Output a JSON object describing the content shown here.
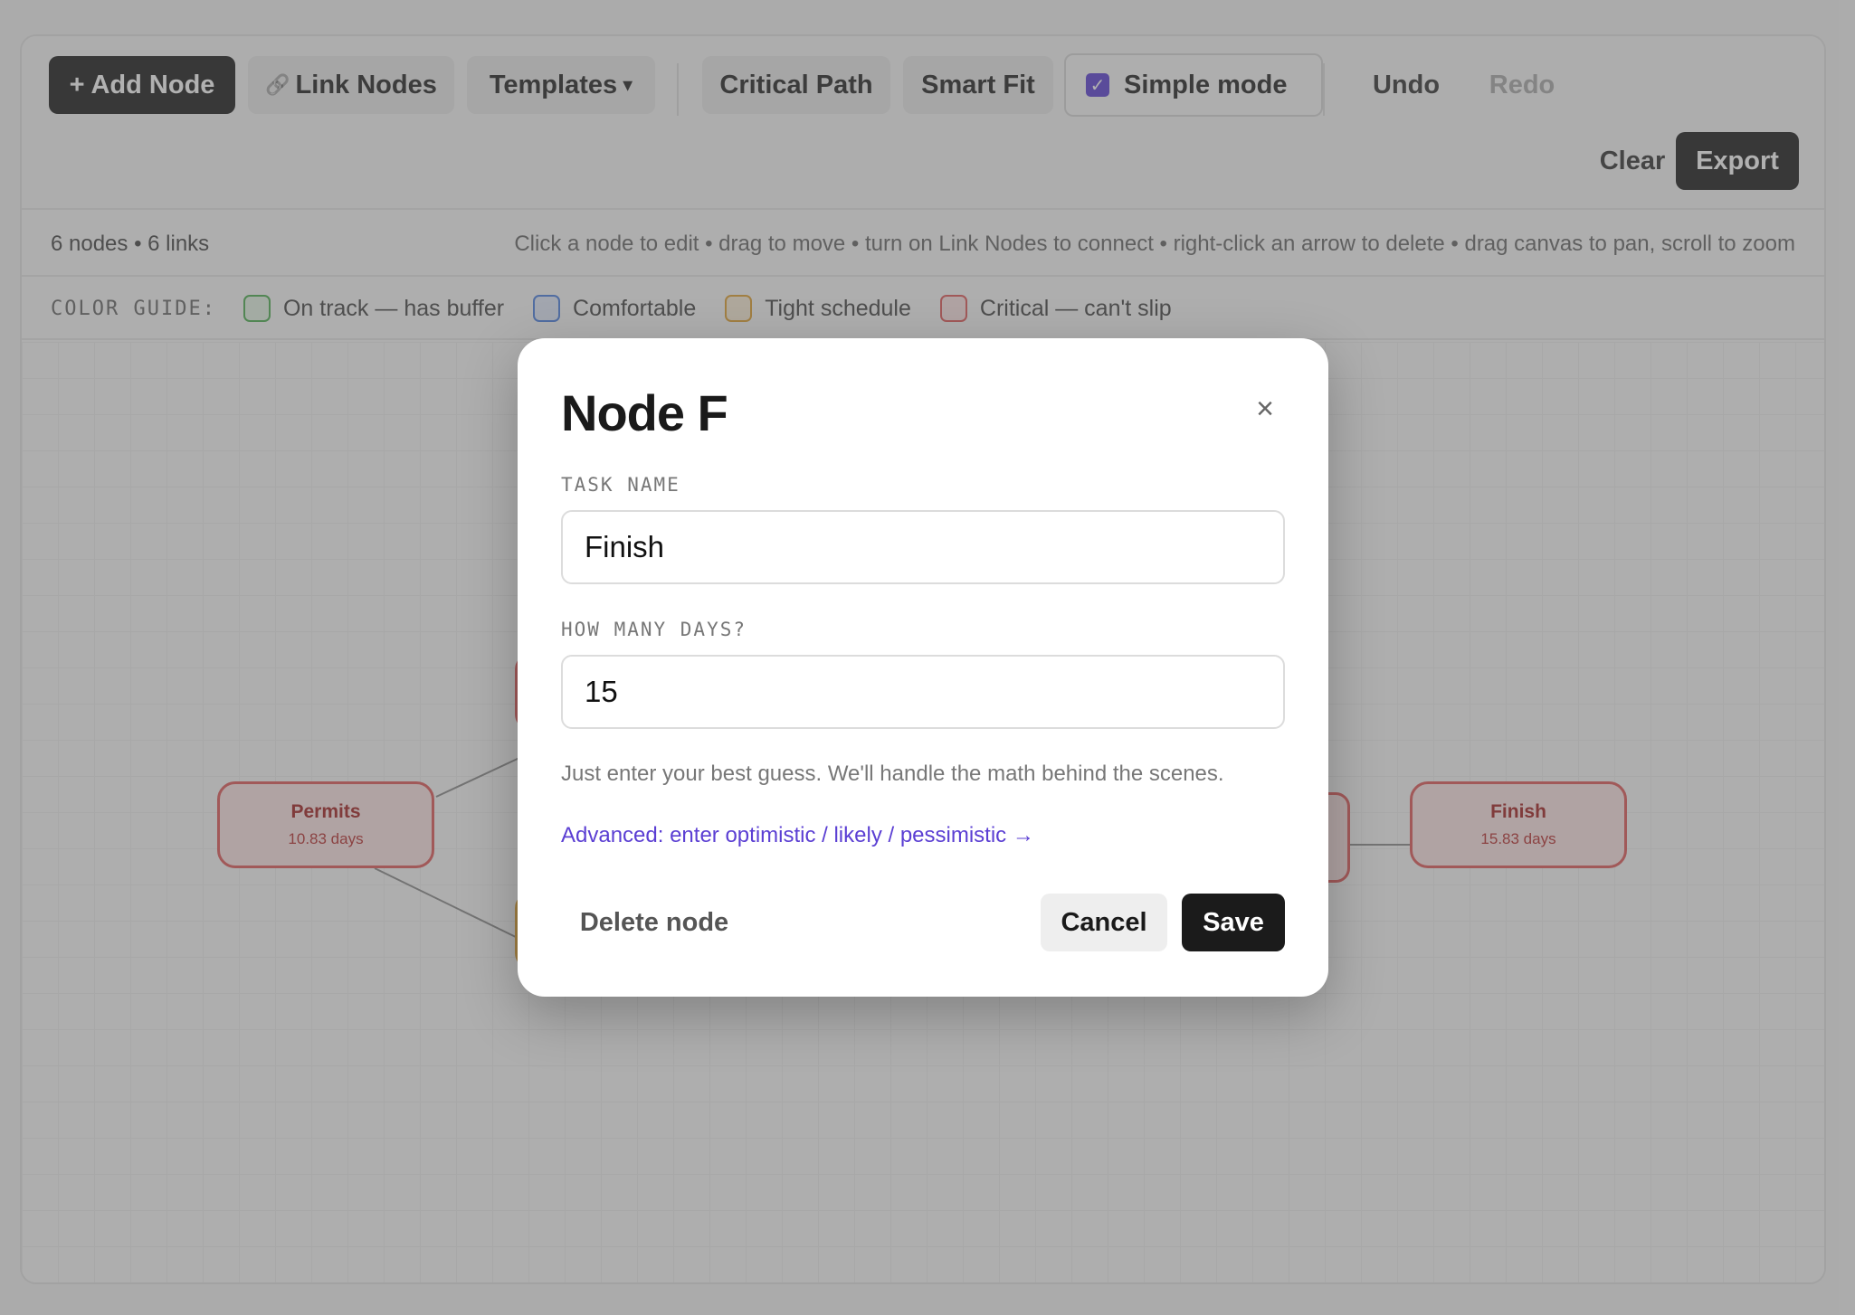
{
  "toolbar": {
    "add_node": "+ Add Node",
    "link_nodes": "Link Nodes",
    "link_icon": "🔗",
    "templates": "Templates",
    "templates_caret": "▾",
    "critical_path": "Critical Path",
    "smart_fit": "Smart Fit",
    "simple_mode": "Simple mode",
    "simple_mode_checked": true,
    "undo": "Undo",
    "redo": "Redo",
    "clear": "Clear",
    "export": "Export"
  },
  "status": {
    "counts": "6 nodes • 6 links",
    "hint": "Click a node to edit • drag to move • turn on Link Nodes to connect • right-click an arrow to delete • drag canvas to pan, scroll to zoom"
  },
  "legend": {
    "label": "COLOR GUIDE:",
    "items": [
      {
        "label": "On track — has buffer",
        "color": "#4caf50"
      },
      {
        "label": "Comfortable",
        "color": "#4a7fe0"
      },
      {
        "label": "Tight schedule",
        "color": "#e0a030"
      },
      {
        "label": "Critical — can't slip",
        "color": "#e05a5a"
      }
    ]
  },
  "nodes": [
    {
      "name": "Permits",
      "duration": "10.83 days"
    },
    {
      "name": "Finish",
      "duration": "15.83 days"
    }
  ],
  "dialog": {
    "title": "Node F",
    "close_icon": "×",
    "task_name_label": "TASK NAME",
    "task_name_value": "Finish",
    "days_label": "HOW MANY DAYS?",
    "days_value": "15",
    "helper": "Just enter your best guess. We'll handle the math behind the scenes.",
    "advanced_link": "Advanced: enter optimistic / likely / pessimistic →",
    "delete": "Delete node",
    "cancel": "Cancel",
    "save": "Save"
  }
}
